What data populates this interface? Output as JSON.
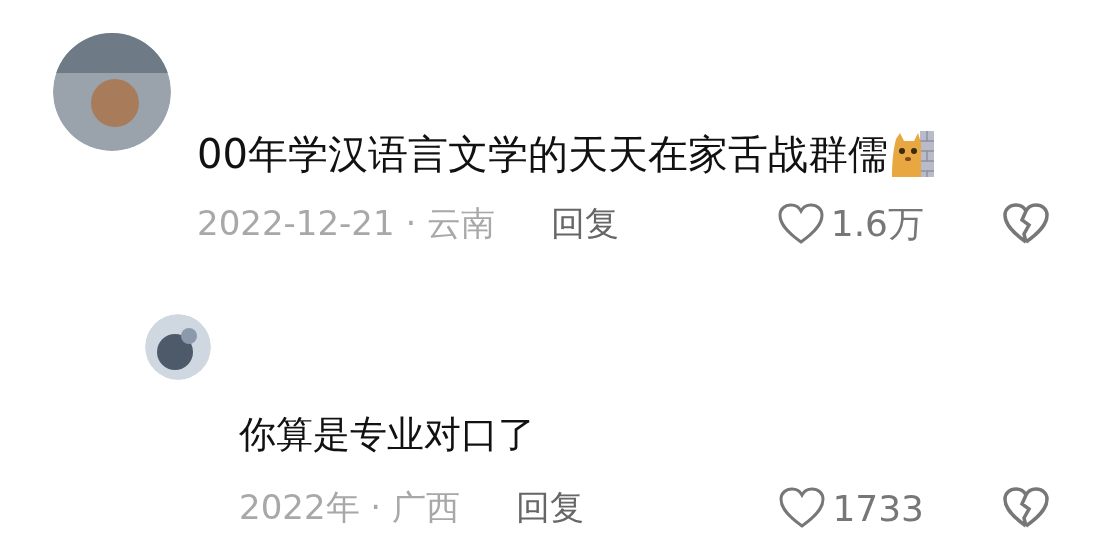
{
  "comments": [
    {
      "text": "00年学汉语言文学的天天在家舌战群儒",
      "sticker": true,
      "date_location": "2022-12-21 · 云南",
      "reply_label": "回复",
      "likes": "1.6万",
      "replies": [
        {
          "text": "你算是专业对口了",
          "date_location": "2022年 · 广西",
          "reply_label": "回复",
          "likes": "1733"
        }
      ]
    }
  ]
}
